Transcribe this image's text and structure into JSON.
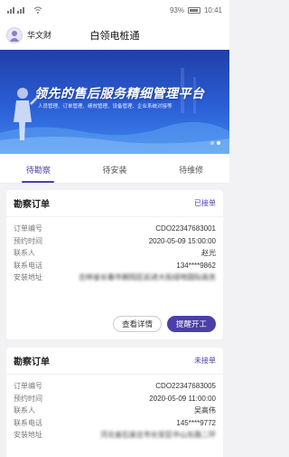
{
  "status_bar": {
    "signal_icons": "all ≋",
    "battery_percent": "93%",
    "time": "10:41"
  },
  "nav": {
    "user_name": "华文财",
    "title": "白领电桩通"
  },
  "banner": {
    "headline": "领先的售后服务精细管理平台",
    "subline": "人员管理、订单管理、绩效管理、设备管理、企业系统对接等",
    "slide_count": 2,
    "active_slide": 2
  },
  "tabs": [
    {
      "label": "待勘察",
      "active": true
    },
    {
      "label": "待安装",
      "active": false
    },
    {
      "label": "待维修",
      "active": false
    }
  ],
  "orders": [
    {
      "title": "勘察订单",
      "status": "已接单",
      "fields": [
        {
          "label": "订单编号",
          "value": "CDO22347683001"
        },
        {
          "label": "预约时间",
          "value": "2020-05-09 15:00:00"
        },
        {
          "label": "联系人",
          "value": "赵光"
        },
        {
          "label": "联系电话",
          "value": "134****9862"
        },
        {
          "label": "安装地址",
          "value": "吉林省长春市朝阳区前进大街绿地国际商务"
        }
      ],
      "actions": {
        "details": "查看详情",
        "remind": "提醒开工"
      }
    },
    {
      "title": "勘察订单",
      "status": "未接单",
      "fields": [
        {
          "label": "订单编号",
          "value": "CDO22347683005"
        },
        {
          "label": "预约时间",
          "value": "2020-05-09 11:00:00"
        },
        {
          "label": "联系人",
          "value": "吴高伟"
        },
        {
          "label": "联系电话",
          "value": "145****9772"
        },
        {
          "label": "安装地址",
          "value": "河北省石家庄市长安区中山东路二环"
        }
      ]
    }
  ],
  "colors": {
    "accent": "#4b3fa8",
    "banner_top": "#1f3fa8",
    "banner_bottom": "#3e86ee"
  }
}
